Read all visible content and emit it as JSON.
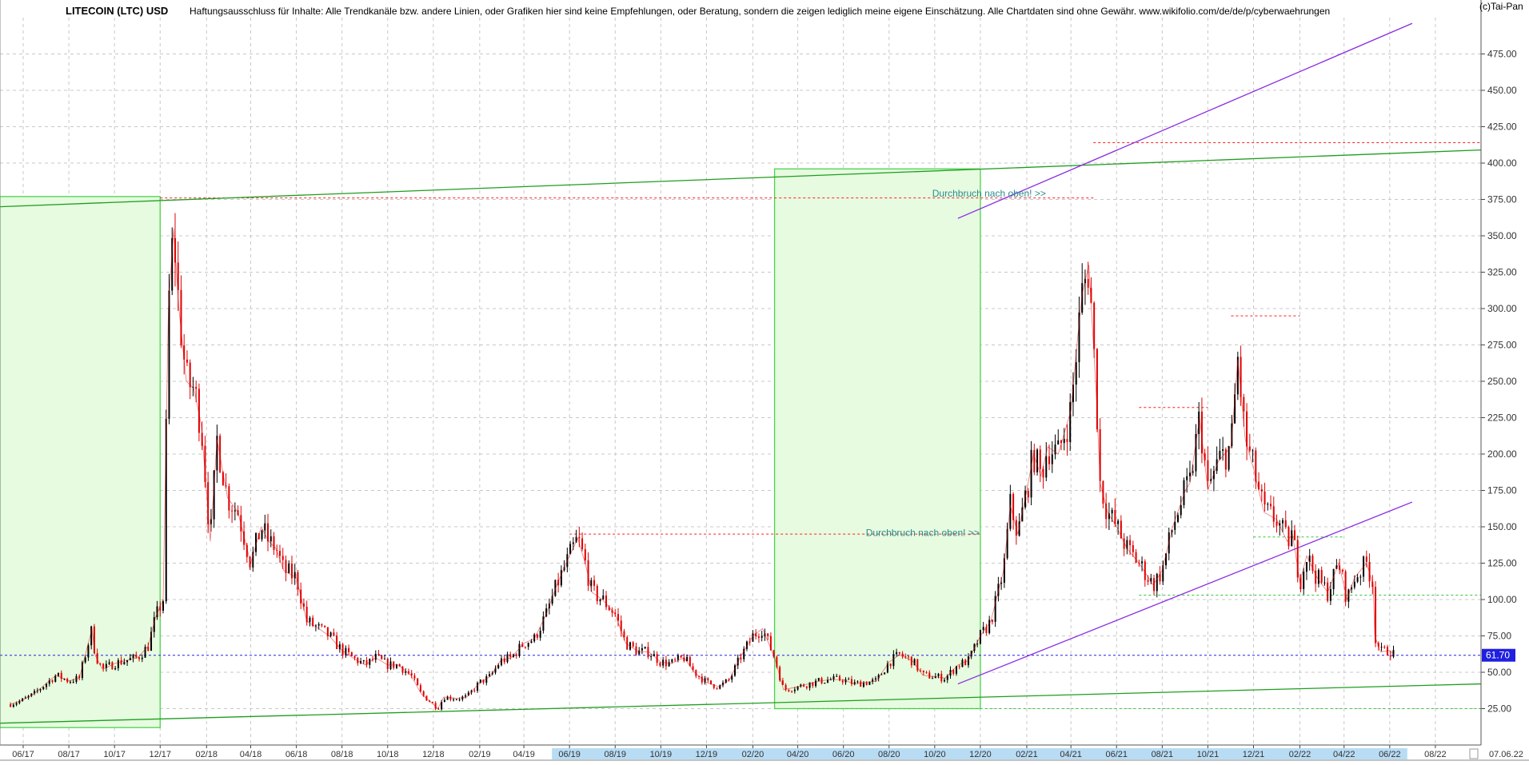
{
  "header": {
    "title": "LITECOIN (LTC) USD",
    "disclaimer": "Haftungsausschluss für Inhalte: Alle Trendkanäle bzw. andere Linien, oder Grafiken hier sind keine Empfehlungen, oder Beratung, sondern die zeigen lediglich meine eigene Einschätzung. Alle Chartdaten sind ohne Gewähr.  www.wikifolio.com/de/de/p/cyberwaehrungen",
    "copyright": "(c)Tai-Pan"
  },
  "colors": {
    "candle_down": "#e00000",
    "candle_up": "#000000",
    "channel_green": "#1e9e1e",
    "box_fill": "#e6fbe0",
    "box_stroke": "#4cd24c",
    "purple": "#8a2be2",
    "red_dash": "#ff2020",
    "blue_dash": "#2222dd",
    "last_price_bg": "#2020e0",
    "annotation": "#2b8c8c",
    "grid": "#c8c8c8",
    "x_highlight": "#b8dcf4"
  },
  "chart_data": {
    "type": "line",
    "title": "LITECOIN (LTC) USD",
    "xlabel": "",
    "ylabel": "",
    "ylim": [
      0,
      500
    ],
    "x_range": [
      "2017-05",
      "2022-10"
    ],
    "grid": true,
    "y_ticks": [
      "25.00",
      "50.00",
      "75.00",
      "100.00",
      "125.00",
      "150.00",
      "175.00",
      "200.00",
      "225.00",
      "250.00",
      "275.00",
      "300.00",
      "325.00",
      "350.00",
      "375.00",
      "400.00",
      "425.00",
      "450.00",
      "475.00"
    ],
    "x_ticks": [
      "06.17",
      "08.17",
      "10.17",
      "12.17",
      "02.18",
      "04.18",
      "06.18",
      "08.18",
      "10.18",
      "12.18",
      "02.19",
      "04.19",
      "06.19",
      "08.19",
      "10.19",
      "12.19",
      "02.20",
      "04.20",
      "06.20",
      "08.20",
      "10.20",
      "12.20",
      "02.21",
      "04.21",
      "06.21",
      "08.21",
      "10.21",
      "12.21",
      "02.22",
      "04.22",
      "06.22",
      "08.22"
    ],
    "x_highlighted_range": [
      "06.19",
      "06.22"
    ],
    "last_date_label": "07.06.22",
    "last_price_label": "61.70",
    "series": [
      {
        "x": [
          "2017-05-15",
          "2017-06-01",
          "2017-06-15",
          "2017-07-01",
          "2017-07-15",
          "2017-08-01",
          "2017-08-15",
          "2017-09-01",
          "2017-09-05",
          "2017-09-15",
          "2017-10-01",
          "2017-10-15",
          "2017-11-01",
          "2017-11-15",
          "2017-11-25",
          "2017-12-05",
          "2017-12-12",
          "2017-12-19",
          "2017-12-26",
          "2018-01-05",
          "2018-01-15",
          "2018-01-25",
          "2018-02-06",
          "2018-02-15",
          "2018-03-01",
          "2018-03-15",
          "2018-04-01",
          "2018-04-15",
          "2018-04-25",
          "2018-05-05",
          "2018-05-15",
          "2018-06-01",
          "2018-06-15",
          "2018-07-01",
          "2018-07-15",
          "2018-08-01",
          "2018-08-15",
          "2018-09-01",
          "2018-09-15",
          "2018-10-01",
          "2018-10-15",
          "2018-11-01",
          "2018-11-15",
          "2018-12-01",
          "2018-12-07",
          "2018-12-15",
          "2019-01-01",
          "2019-01-15",
          "2019-02-01",
          "2019-02-15",
          "2019-03-01",
          "2019-03-15",
          "2019-04-01",
          "2019-04-15",
          "2019-05-01",
          "2019-05-15",
          "2019-06-01",
          "2019-06-12",
          "2019-06-22",
          "2019-07-01",
          "2019-07-15",
          "2019-08-01",
          "2019-08-15",
          "2019-09-01",
          "2019-09-15",
          "2019-10-01",
          "2019-10-15",
          "2019-11-01",
          "2019-11-15",
          "2019-12-01",
          "2019-12-18",
          "2020-01-01",
          "2020-01-15",
          "2020-02-01",
          "2020-02-14",
          "2020-03-01",
          "2020-03-13",
          "2020-04-01",
          "2020-04-15",
          "2020-05-01",
          "2020-05-15",
          "2020-06-01",
          "2020-06-15",
          "2020-07-01",
          "2020-07-15",
          "2020-08-01",
          "2020-08-15",
          "2020-09-01",
          "2020-09-15",
          "2020-10-01",
          "2020-10-15",
          "2020-11-01",
          "2020-11-15",
          "2020-12-01",
          "2020-12-15",
          "2021-01-01",
          "2021-01-10",
          "2021-01-20",
          "2021-02-01",
          "2021-02-10",
          "2021-02-20",
          "2021-03-01",
          "2021-03-15",
          "2021-04-01",
          "2021-04-10",
          "2021-04-16",
          "2021-04-25",
          "2021-05-05",
          "2021-05-10",
          "2021-05-20",
          "2021-06-01",
          "2021-06-15",
          "2021-07-01",
          "2021-07-20",
          "2021-08-01",
          "2021-08-15",
          "2021-09-01",
          "2021-09-07",
          "2021-09-20",
          "2021-10-01",
          "2021-10-15",
          "2021-11-01",
          "2021-11-10",
          "2021-11-20",
          "2021-12-01",
          "2021-12-15",
          "2022-01-01",
          "2022-01-15",
          "2022-01-22",
          "2022-02-01",
          "2022-02-10",
          "2022-02-24",
          "2022-03-10",
          "2022-03-25",
          "2022-04-05",
          "2022-04-15",
          "2022-05-01",
          "2022-05-10",
          "2022-05-12",
          "2022-05-20",
          "2022-06-01",
          "2022-06-07"
        ],
        "y": [
          28,
          31,
          35,
          42,
          48,
          44,
          46,
          80,
          62,
          52,
          56,
          58,
          60,
          68,
          88,
          100,
          300,
          355,
          300,
          250,
          245,
          220,
          140,
          210,
          170,
          160,
          125,
          150,
          140,
          135,
          120,
          115,
          85,
          80,
          75,
          65,
          60,
          55,
          60,
          55,
          55,
          48,
          35,
          28,
          25,
          33,
          32,
          33,
          43,
          47,
          58,
          60,
          70,
          73,
          90,
          110,
          130,
          142,
          125,
          105,
          100,
          90,
          70,
          64,
          64,
          57,
          56,
          60,
          50,
          43,
          40,
          45,
          60,
          75,
          80,
          60,
          38,
          40,
          42,
          44,
          45,
          45,
          42,
          43,
          44,
          57,
          62,
          58,
          48,
          47,
          46,
          55,
          58,
          75,
          85,
          120,
          165,
          145,
          175,
          200,
          185,
          205,
          200,
          230,
          280,
          310,
          330,
          240,
          180,
          160,
          150,
          135,
          125,
          110,
          120,
          150,
          175,
          180,
          225,
          175,
          195,
          205,
          265,
          210,
          190,
          160,
          155,
          140,
          145,
          112,
          130,
          115,
          105,
          125,
          100,
          115,
          125,
          110,
          75,
          64,
          65,
          62
        ]
      }
    ],
    "trendlines": [
      {
        "name": "upper-channel",
        "style": "solid",
        "from": [
          "2017-05",
          370
        ],
        "to": [
          "2022-10",
          409
        ]
      },
      {
        "name": "lower-channel",
        "style": "solid",
        "from": [
          "2017-05",
          15
        ],
        "to": [
          "2022-10",
          42
        ]
      },
      {
        "name": "purple-upper",
        "style": "solid",
        "from": [
          "2020-11",
          362
        ],
        "to": [
          "2022-07",
          496
        ]
      },
      {
        "name": "purple-lower",
        "style": "solid",
        "from": [
          "2020-11",
          42
        ],
        "to": [
          "2022-07",
          167
        ]
      }
    ],
    "levels": [
      {
        "name": "resistance-375",
        "value": 376,
        "from": "2017-12",
        "to": "2021-05"
      },
      {
        "name": "ath-414",
        "value": 414,
        "from": "2021-05",
        "to": "2022-10"
      },
      {
        "name": "level-295",
        "value": 295,
        "from": "2021-11",
        "to": "2022-02"
      },
      {
        "name": "level-232",
        "value": 232,
        "from": "2021-07",
        "to": "2021-10"
      },
      {
        "name": "level-145",
        "value": 145,
        "from": "2019-06",
        "to": "2020-12"
      },
      {
        "name": "level-143",
        "value": 143,
        "from": "2021-12",
        "to": "2022-04"
      },
      {
        "name": "level-103",
        "value": 103,
        "from": "2021-07",
        "to": "2022-10"
      },
      {
        "name": "level-25",
        "value": 25,
        "from": "2020-04",
        "to": "2022-10"
      },
      {
        "name": "last-price",
        "value": 61.7,
        "from": "2017-05",
        "to": "2022-10"
      }
    ],
    "boxes": [
      {
        "name": "box-2017",
        "from": "2017-05",
        "to": "2017-12",
        "y_from": 12,
        "y_to": 377
      },
      {
        "name": "box-2020",
        "from": "2020-03",
        "to": "2020-12",
        "y_from": 25,
        "y_to": 396
      }
    ],
    "annotations": [
      {
        "name": "breakout-upper",
        "text": "Durchbruch nach oben! >>",
        "x": "2020-09",
        "y": 379
      },
      {
        "name": "breakout-lower",
        "text": "Durchbruch nach oben! >>",
        "x": "2020-07",
        "y": 146
      }
    ]
  }
}
